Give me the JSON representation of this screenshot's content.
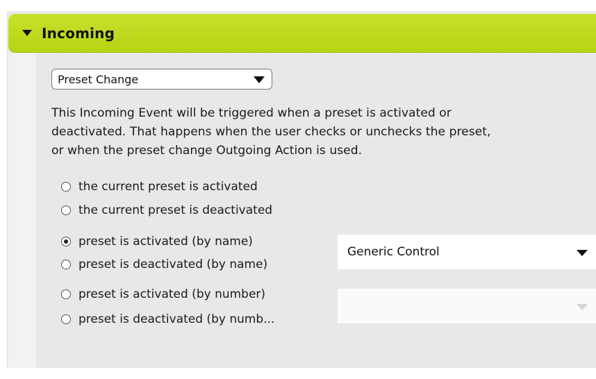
{
  "header": {
    "title": "Incoming",
    "collapse_icon": "triangle-down-icon",
    "color": "#bdd81e"
  },
  "event_type": {
    "selected": "Preset Change",
    "arrow_icon": "triangle-down-icon"
  },
  "description": {
    "line1": "This Incoming Event will be triggered when a preset is activated or",
    "line2": "deactivated. That happens when the user checks or unchecks the preset,",
    "line3": "or when the preset change Outgoing Action is used."
  },
  "options": [
    {
      "label": "the current preset is activated",
      "checked": false
    },
    {
      "label": "the current preset is deactivated",
      "checked": false
    },
    {
      "label": "preset is activated (by name)",
      "checked": true
    },
    {
      "label": "preset is deactivated (by name)",
      "checked": false
    },
    {
      "label": "preset is activated (by number)",
      "checked": false
    },
    {
      "label": "preset is deactivated (by numb...",
      "checked": false
    }
  ],
  "preset_name_select": {
    "selected": "Generic Control",
    "arrow_icon": "triangle-down-icon"
  },
  "preset_number_select": {
    "selected": "",
    "arrow_icon": "triangle-down-icon",
    "disabled": true
  }
}
